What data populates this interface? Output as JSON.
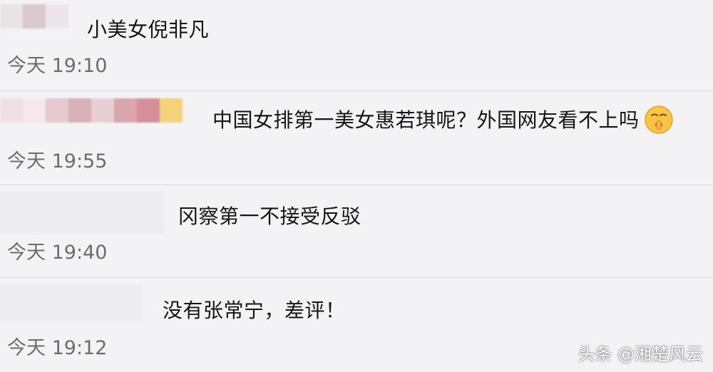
{
  "comments": [
    {
      "text": "小美女倪非凡",
      "time": "今天 19:10"
    },
    {
      "text": "中国女排第一美女惠若琪呢？外国网友看不上吗",
      "emoji": "shushing-face-icon",
      "time": "今天 19:55"
    },
    {
      "text": "冈察第一不接受反驳",
      "time": "今天 19:40"
    },
    {
      "text": "没有张常宁，差评！",
      "time": "今天 19:12"
    }
  ],
  "watermark": "头条 @湘楚风云",
  "colors": {
    "background": "#f3f3f5",
    "divider": "#d9d9dc",
    "text": "#151515",
    "time": "#6c6c70"
  }
}
